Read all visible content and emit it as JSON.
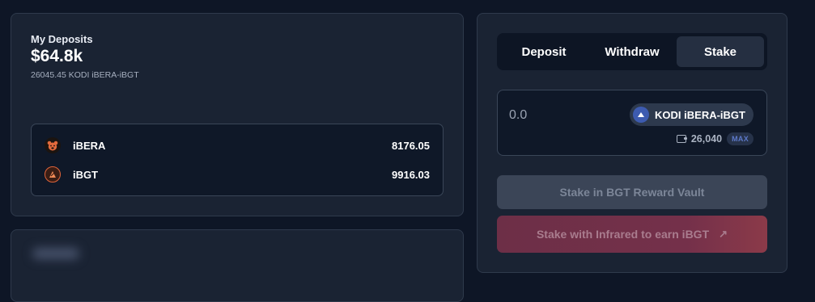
{
  "deposits": {
    "title": "My Deposits",
    "usd_value": "$64.8k",
    "token_amount": "26045.45 KODI iBERA-iBGT",
    "tokens": [
      {
        "name": "iBERA",
        "value": "8176.05",
        "icon": "bear-icon"
      },
      {
        "name": "iBGT",
        "value": "9916.03",
        "icon": "ibgt-icon"
      }
    ]
  },
  "action": {
    "tabs": [
      {
        "label": "Deposit",
        "active": false
      },
      {
        "label": "Withdraw",
        "active": false
      },
      {
        "label": "Stake",
        "active": true
      }
    ],
    "amount_placeholder": "0.0",
    "token_label": "KODI iBERA-iBGT",
    "balance": "26,040",
    "max_label": "MAX",
    "stake_vault_label": "Stake in BGT Reward Vault",
    "stake_infrared_label": "Stake with Infrared to earn iBGT"
  },
  "colors": {
    "background": "#0e1626",
    "card": "#1a2333",
    "accent_infrared": "#74304a"
  }
}
